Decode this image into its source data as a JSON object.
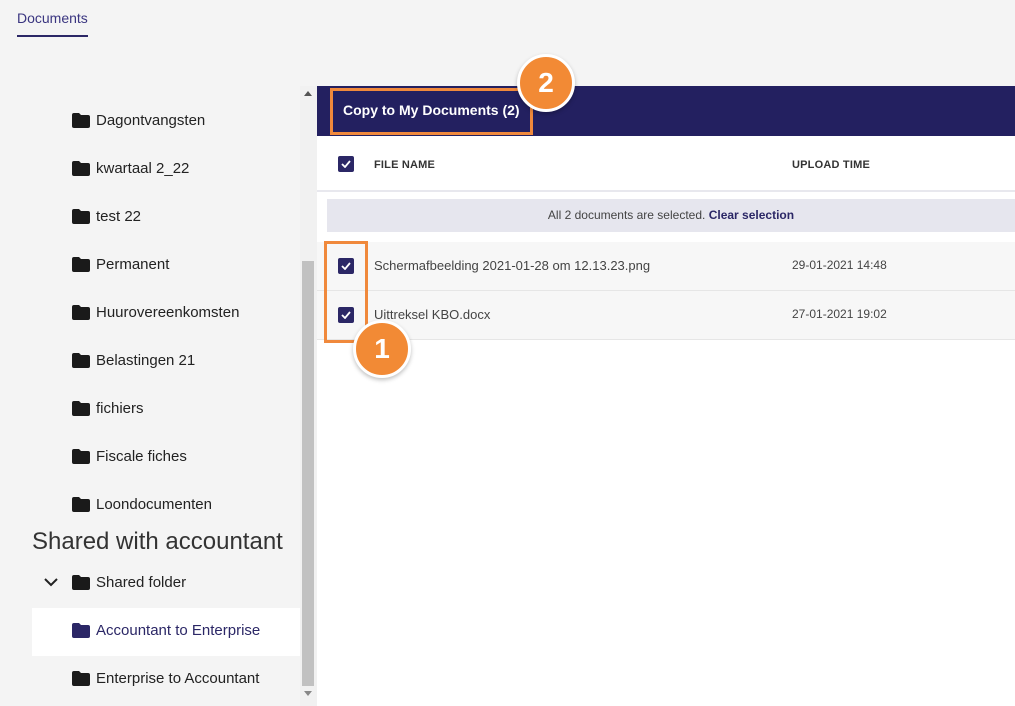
{
  "header": {
    "tab_label": "Documents"
  },
  "sidebar": {
    "folders_top": [
      {
        "label": "Dagontvangsten"
      },
      {
        "label": "kwartaal 2_22"
      },
      {
        "label": "test 22"
      },
      {
        "label": "Permanent"
      },
      {
        "label": "Huurovereenkomsten"
      },
      {
        "label": "Belastingen 21"
      },
      {
        "label": "fichiers"
      },
      {
        "label": "Fiscale fiches"
      },
      {
        "label": "Loondocumenten"
      }
    ],
    "shared_section_title": "Shared with accountant",
    "shared_folder": {
      "label": "Shared folder"
    },
    "shared_children": [
      {
        "label": "Accountant to Enterprise",
        "active": true
      },
      {
        "label": "Enterprise to Accountant",
        "active": false
      }
    ]
  },
  "toolbar": {
    "copy_label": "Copy to My Documents (2)"
  },
  "table": {
    "col_file_name": "FILE NAME",
    "col_upload_time": "UPLOAD TIME",
    "selection_text": "All 2 documents are selected.",
    "clear_selection": "Clear selection",
    "rows": [
      {
        "name": "Schermafbeelding 2021-01-28 om 12.13.23.png",
        "time": "29-01-2021 14:48",
        "checked": true
      },
      {
        "name": "Uittreksel KBO.docx",
        "time": "27-01-2021 19:02",
        "checked": true
      }
    ]
  },
  "annotations": {
    "badge_1": "1",
    "badge_2": "2"
  },
  "colors": {
    "brand": "#232060",
    "accent": "#2b2766",
    "callout": "#f28a35"
  }
}
